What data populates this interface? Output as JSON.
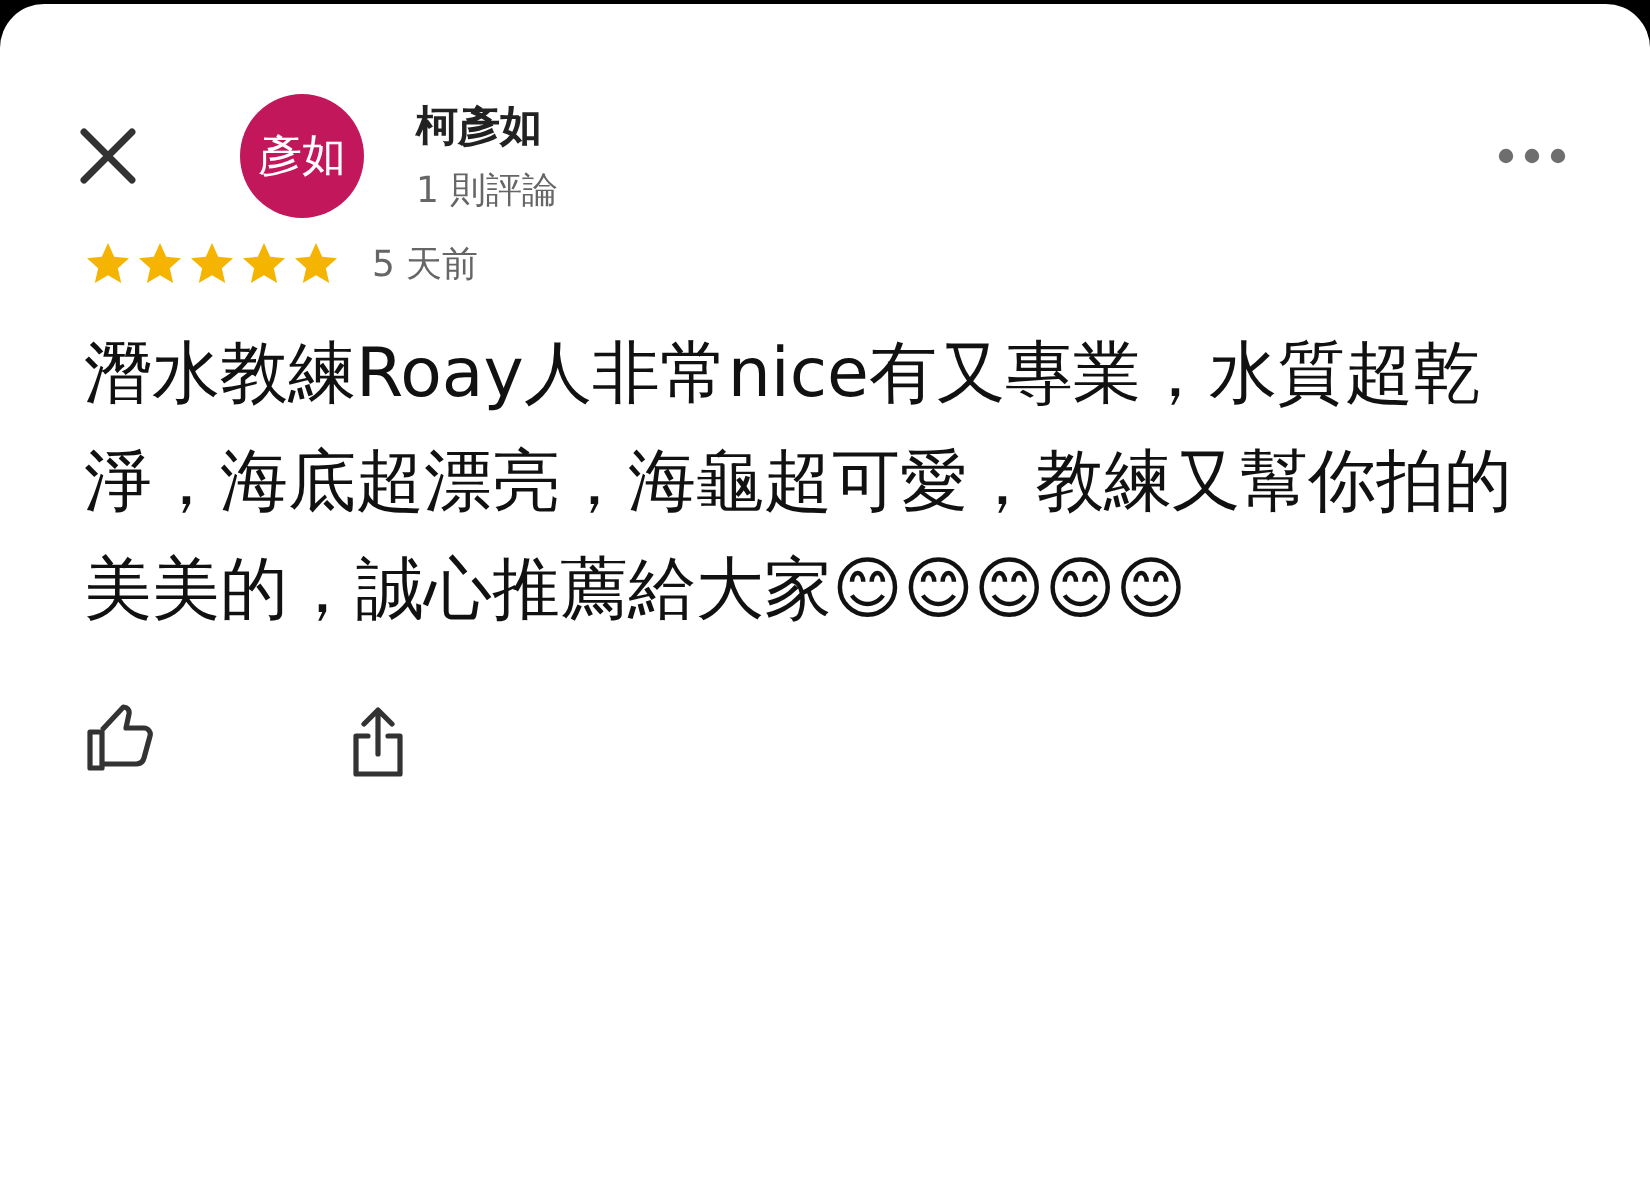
{
  "reviewer": {
    "avatar_text": "彥如",
    "name": "柯彥如",
    "review_count": "1 則評論"
  },
  "rating": {
    "stars": 5
  },
  "time": "5 天前",
  "review_text": "潛水教練Roay人非常nice有又專業，水質超乾淨，海底超漂亮，海龜超可愛，教練又幫你拍的美美的，誠心推薦給大家😊😊😊😊😊"
}
